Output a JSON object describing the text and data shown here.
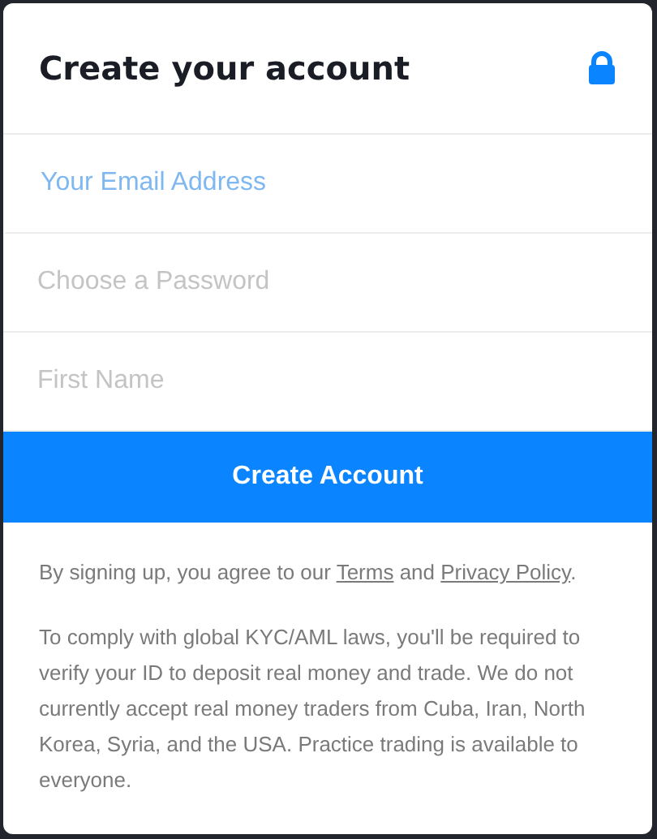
{
  "title": "Create your account",
  "fields": [
    {
      "placeholder": "Your Email Address",
      "focused": true
    },
    {
      "placeholder": "Choose a Password",
      "focused": false
    },
    {
      "placeholder": "First Name",
      "focused": false
    }
  ],
  "submit_button": "Create Account",
  "agreement": [
    {
      "kind": "text",
      "text": "By signing up, you agree to our "
    },
    {
      "kind": "link",
      "text": "Terms"
    },
    {
      "kind": "text",
      "text": " and "
    },
    {
      "kind": "link",
      "text": "Privacy Policy"
    },
    {
      "kind": "text",
      "text": "."
    }
  ],
  "notice": "To comply with global KYC/AML laws, you'll be required to verify your ID to deposit real money and trade. We do not currently accept real money traders from Cuba, Iran, North Korea, Syria, and the USA. Practice trading is available to everyone."
}
